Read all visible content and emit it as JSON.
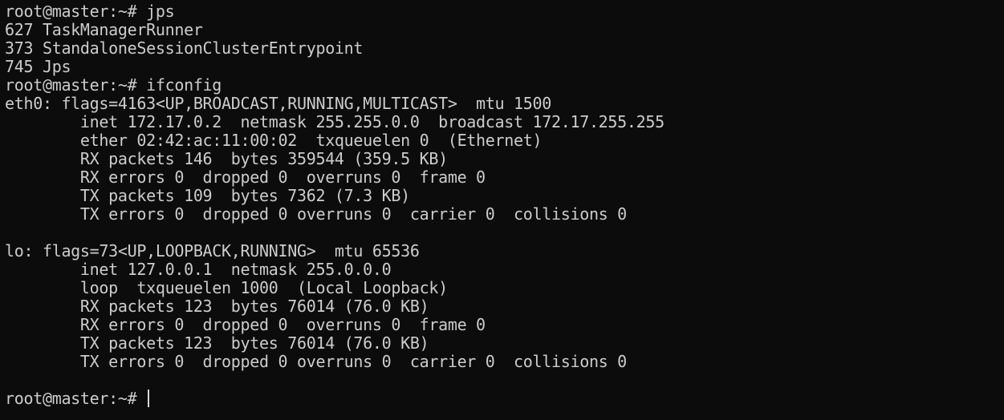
{
  "terminal": {
    "lines": [
      "root@master:~# jps",
      "627 TaskManagerRunner",
      "373 StandaloneSessionClusterEntrypoint",
      "745 Jps",
      "root@master:~# ifconfig",
      "eth0: flags=4163<UP,BROADCAST,RUNNING,MULTICAST>  mtu 1500",
      "        inet 172.17.0.2  netmask 255.255.0.0  broadcast 172.17.255.255",
      "        ether 02:42:ac:11:00:02  txqueuelen 0  (Ethernet)",
      "        RX packets 146  bytes 359544 (359.5 KB)",
      "        RX errors 0  dropped 0  overruns 0  frame 0",
      "        TX packets 109  bytes 7362 (7.3 KB)",
      "        TX errors 0  dropped 0 overruns 0  carrier 0  collisions 0",
      "",
      "lo: flags=73<UP,LOOPBACK,RUNNING>  mtu 65536",
      "        inet 127.0.0.1  netmask 255.0.0.0",
      "        loop  txqueuelen 1000  (Local Loopback)",
      "        RX packets 123  bytes 76014 (76.0 KB)",
      "        RX errors 0  dropped 0  overruns 0  frame 0",
      "        TX packets 123  bytes 76014 (76.0 KB)",
      "        TX errors 0  dropped 0 overruns 0  carrier 0  collisions 0",
      ""
    ],
    "prompt": "root@master:~# ",
    "colors": {
      "background": "#0c0c0c",
      "text": "#cccccc",
      "cursor": "#d8d8d8"
    }
  }
}
